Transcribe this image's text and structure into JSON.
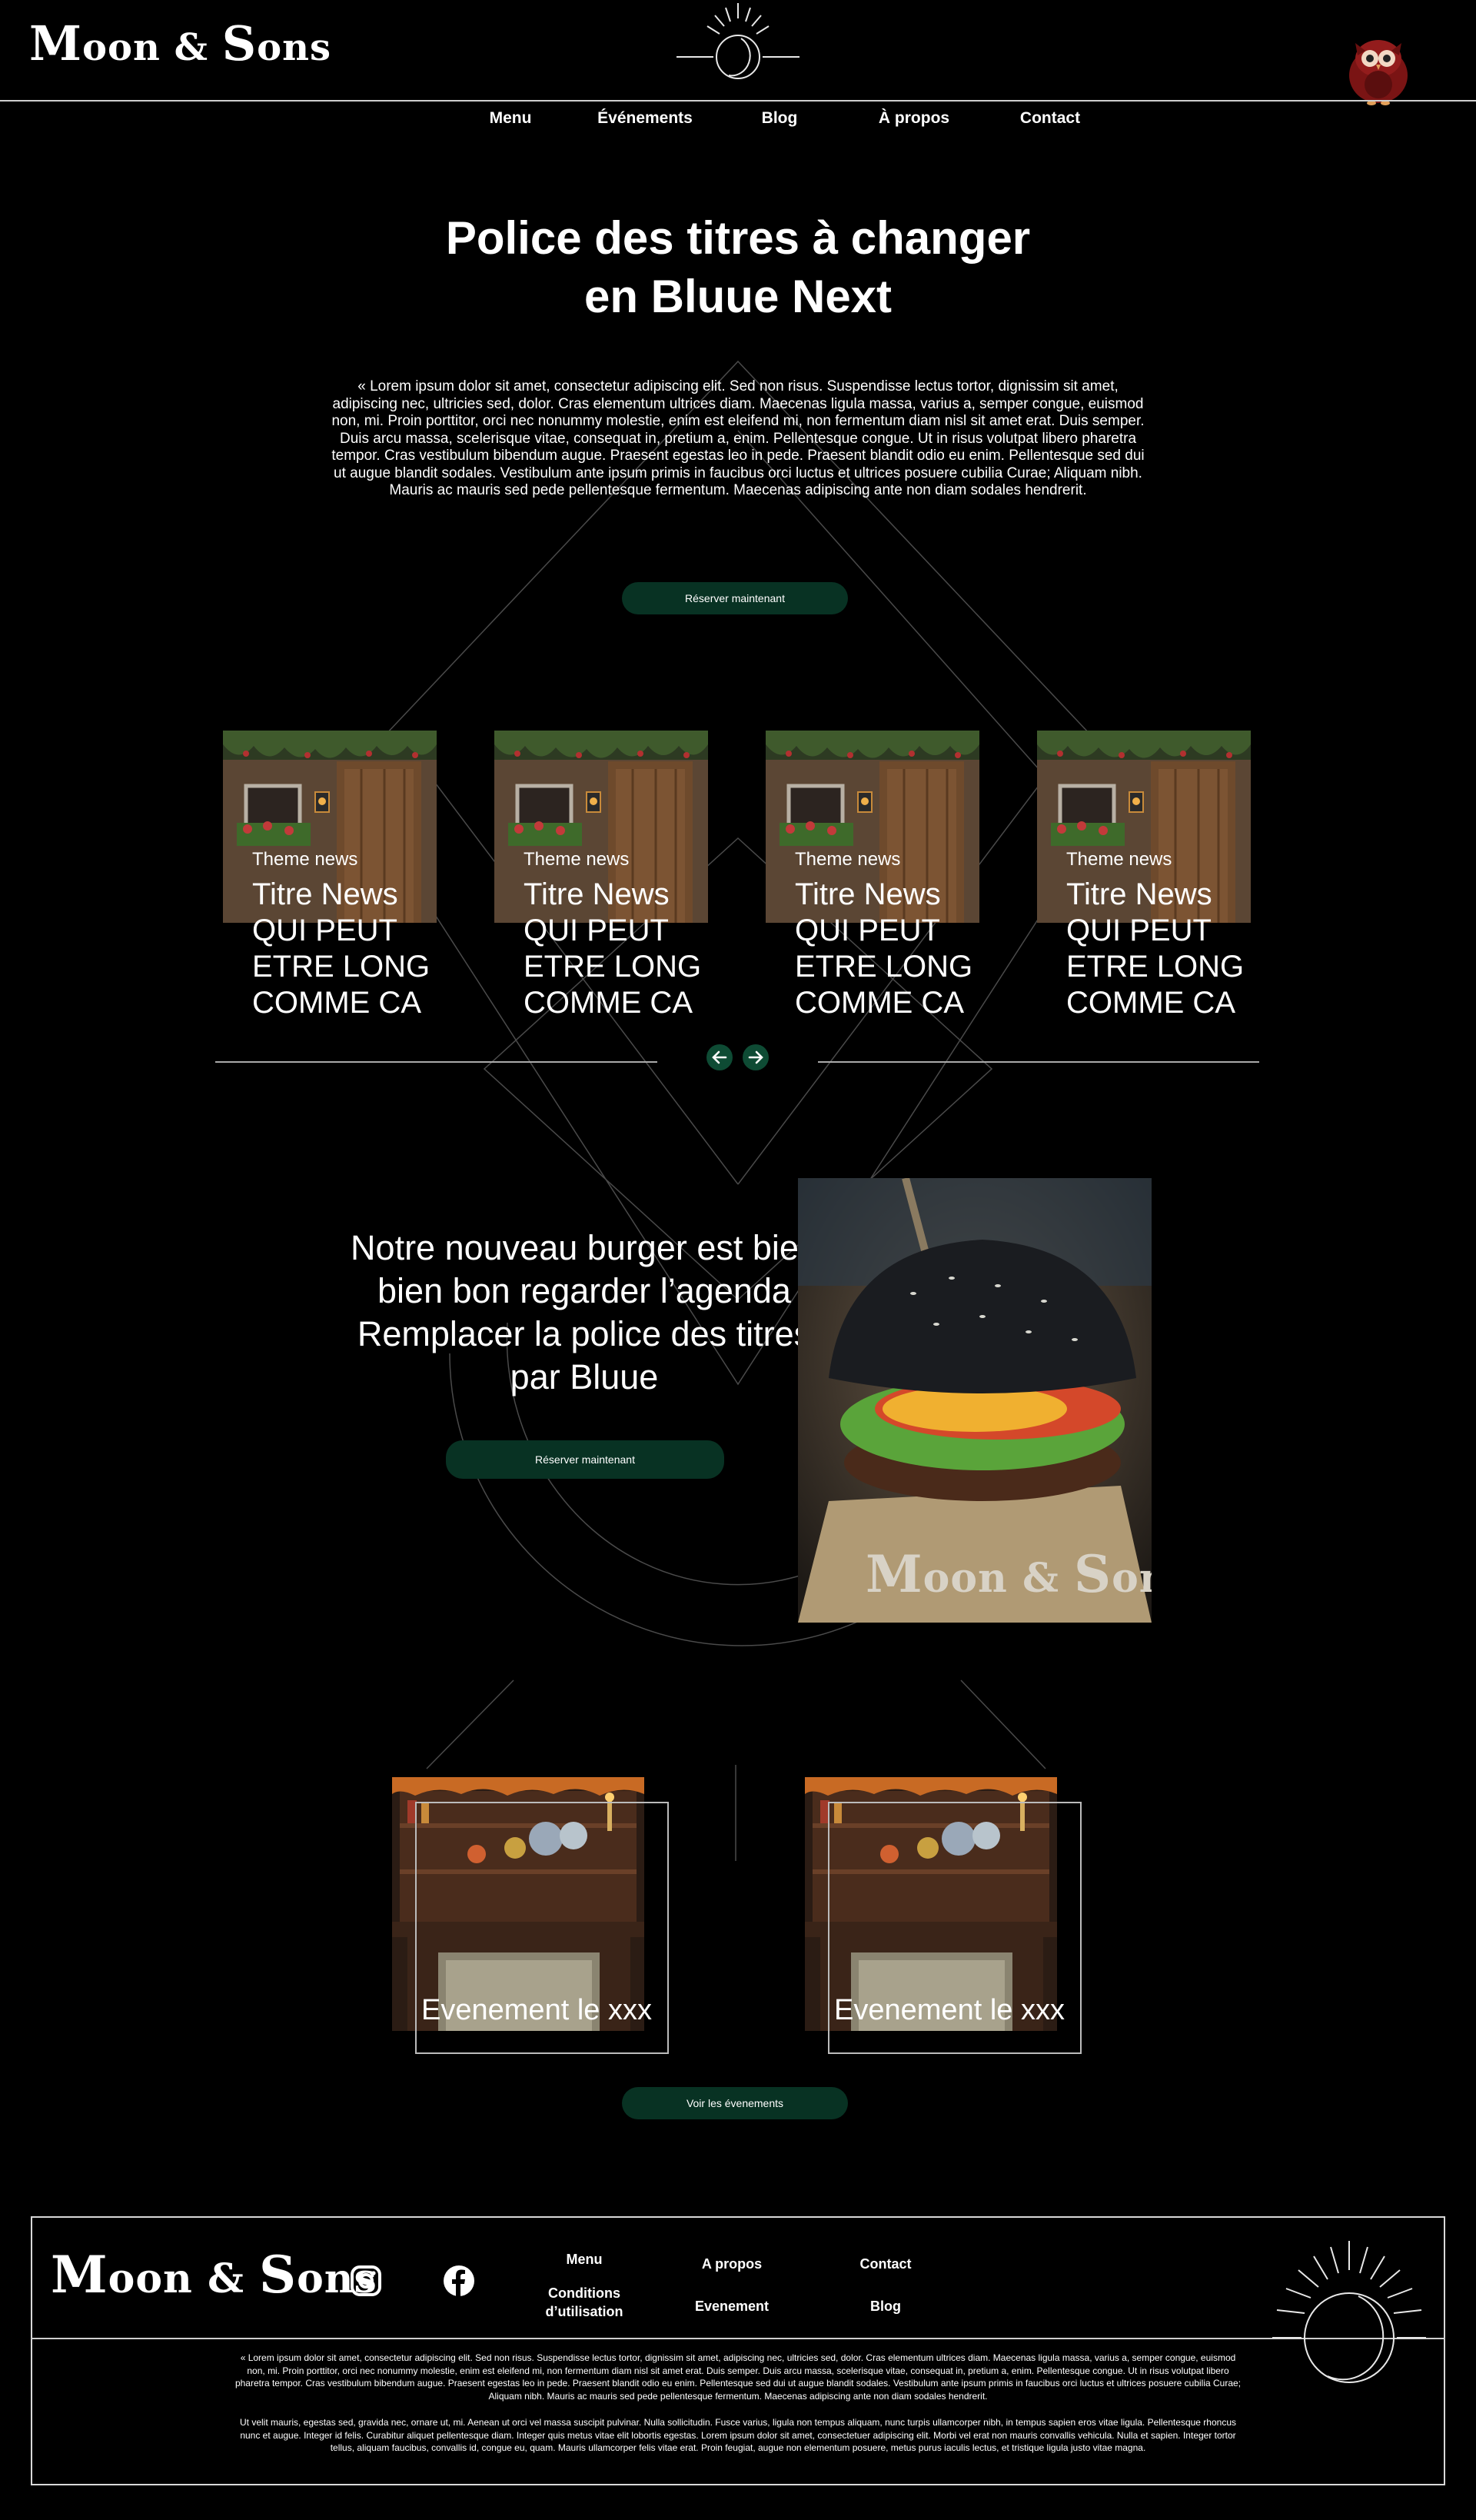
{
  "header": {
    "logo_main": "M",
    "logo_rest": "oon & ",
    "logo_main2": "S",
    "logo_rest2": "ons"
  },
  "nav": {
    "items": [
      {
        "label": "Menu"
      },
      {
        "label": "Événements"
      },
      {
        "label": "Blog"
      },
      {
        "label": "À propos"
      },
      {
        "label": "Contact"
      }
    ]
  },
  "hero": {
    "title_line1": "Police des titres à changer",
    "title_line2": "en Bluue Next",
    "text": "« Lorem ipsum dolor sit amet, consectetur adipiscing elit. Sed non risus. Suspendisse lectus tortor, dignissim sit amet, adipiscing nec, ultricies sed, dolor. Cras elementum ultrices diam. Maecenas ligula massa, varius a, semper congue, euismod non, mi. Proin porttitor, orci nec nonummy molestie, enim est eleifend mi, non fermentum diam nisl sit amet erat. Duis semper. Duis arcu massa, scelerisque vitae, consequat in, pretium a, enim. Pellentesque congue. Ut in risus volutpat libero pharetra tempor. Cras vestibulum bibendum augue. Praesent egestas leo in pede. Praesent blandit odio eu enim. Pellentesque sed dui ut augue blandit sodales. Vestibulum ante ipsum primis in faucibus orci luctus et ultrices posuere cubilia Curae; Aliquam nibh. Mauris ac mauris sed pede pellentesque fermentum. Maecenas adipiscing ante non diam sodales hendrerit.",
    "cta": "Réserver maintenant"
  },
  "news": {
    "cards": [
      {
        "theme": "Theme news",
        "title": "Titre News QUI PEUT ETRE LONG COMME CA"
      },
      {
        "theme": "Theme news",
        "title": "Titre News QUI PEUT ETRE LONG COMME CA"
      },
      {
        "theme": "Theme news",
        "title": "Titre News QUI PEUT ETRE LONG COMME CA"
      },
      {
        "theme": "Theme news",
        "title": "Titre News QUI PEUT ETRE LONG COMME CA"
      }
    ]
  },
  "feature": {
    "title": "Notre nouveau burger est bien bien bon regarder l’agenda Remplacer la police des titres par Bluue",
    "cta": "Réserver maintenant"
  },
  "events": {
    "items": [
      {
        "label": "Evenement le xxx"
      },
      {
        "label": "Evenement le xxx"
      }
    ],
    "cta": "Voir les évenements"
  },
  "footer": {
    "links": [
      {
        "label": "Menu"
      },
      {
        "label": "Conditions d’utilisation"
      },
      {
        "label": "A propos"
      },
      {
        "label": "Evenement"
      },
      {
        "label": "Contact"
      },
      {
        "label": "Blog"
      }
    ],
    "text1": "« Lorem ipsum dolor sit amet, consectetur adipiscing elit. Sed non risus. Suspendisse lectus tortor, dignissim sit amet, adipiscing nec, ultricies sed, dolor. Cras elementum ultrices diam. Maecenas ligula massa, varius a, semper congue, euismod non, mi. Proin porttitor, orci nec nonummy molestie, enim est eleifend mi, non fermentum diam nisl sit amet erat. Duis semper. Duis arcu massa, scelerisque vitae, consequat in, pretium a, enim. Pellentesque congue. Ut in risus volutpat libero pharetra tempor. Cras vestibulum bibendum augue. Praesent egestas leo in pede. Praesent blandit odio eu enim. Pellentesque sed dui ut augue blandit sodales. Vestibulum ante ipsum primis in faucibus orci luctus et ultrices posuere cubilia Curae; Aliquam nibh. Mauris ac mauris sed pede pellentesque fermentum. Maecenas adipiscing ante non diam sodales hendrerit.",
    "text2": "Ut velit mauris, egestas sed, gravida nec, ornare ut, mi. Aenean ut orci vel massa suscipit pulvinar. Nulla sollicitudin. Fusce varius, ligula non tempus aliquam, nunc turpis ullamcorper nibh, in tempus sapien eros vitae ligula. Pellentesque rhoncus nunc et augue. Integer id felis. Curabitur aliquet pellentesque diam. Integer quis metus vitae elit lobortis egestas. Lorem ipsum dolor sit amet, consectetuer adipiscing elit. Morbi vel erat non mauris convallis vehicula. Nulla et sapien. Integer tortor tellus, aliquam faucibus, convallis id, congue eu, quam. Mauris ullamcorper felis vitae erat. Proin feugiat, augue non elementum posuere, metus purus iaculis lectus, et tristique ligula justo vitae magna."
  }
}
